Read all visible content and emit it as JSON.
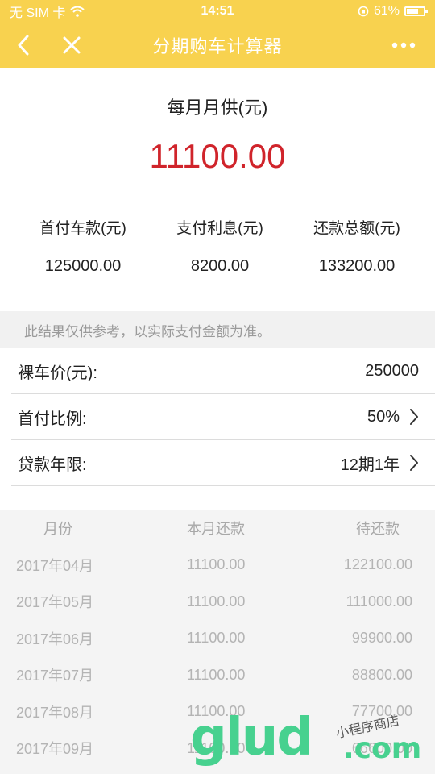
{
  "status_bar": {
    "carrier": "无 SIM 卡",
    "time": "14:51",
    "battery": "61%"
  },
  "nav": {
    "title": "分期购车计算器"
  },
  "summary": {
    "monthly_label": "每月月供(元)",
    "monthly_value": "11100.00",
    "stats": [
      {
        "label": "首付车款(元)",
        "value": "125000.00"
      },
      {
        "label": "支付利息(元)",
        "value": "8200.00"
      },
      {
        "label": "还款总额(元)",
        "value": "133200.00"
      }
    ]
  },
  "note": "此结果仅供参考，以实际支付金额为准。",
  "form": {
    "price_label": "裸车价(元):",
    "price_value": "250000",
    "down_label": "首付比例:",
    "down_value": "50%",
    "term_label": "贷款年限:",
    "term_value": "12期1年"
  },
  "table": {
    "headers": [
      "月份",
      "本月还款",
      "待还款"
    ],
    "rows": [
      [
        "2017年04月",
        "11100.00",
        "122100.00"
      ],
      [
        "2017年05月",
        "11100.00",
        "111000.00"
      ],
      [
        "2017年06月",
        "11100.00",
        "99900.00"
      ],
      [
        "2017年07月",
        "11100.00",
        "88800.00"
      ],
      [
        "2017年08月",
        "11100.00",
        "77700.00"
      ],
      [
        "2017年09月",
        "11100.00",
        "66600.00"
      ]
    ]
  },
  "watermark": {
    "main": "glud",
    "domain": ".com",
    "tagline": "小程序商店"
  },
  "colors": {
    "header": "#f8d24f",
    "monthly_value": "#d0242b"
  }
}
